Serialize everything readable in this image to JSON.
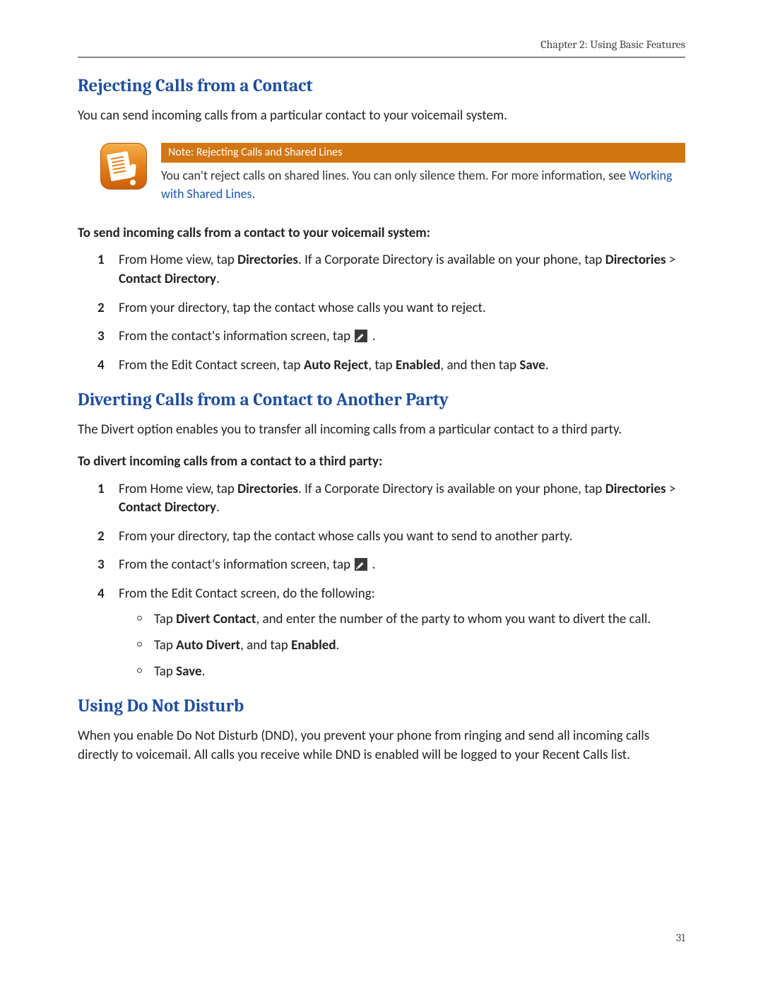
{
  "header": {
    "chapter": "Chapter 2: Using Basic Features"
  },
  "page_number": "31",
  "s1": {
    "title": "Rejecting Calls from a Contact",
    "intro": "You can send incoming calls from a particular contact to your voicemail system.",
    "note": {
      "title": "Note: Rejecting Calls and Shared Lines",
      "before_link": "You can't reject calls on shared lines. You can only silence them. For more information, see ",
      "link": "Working with Shared Lines",
      "after_link": "."
    },
    "subhead": "To send incoming calls from a contact to your voicemail system:",
    "step1_a": "From Home view, tap ",
    "step1_dir": "Directories",
    "step1_b": ". If a Corporate Directory is available on your phone, tap ",
    "step1_dir2": "Directories",
    "step1_gt": " > ",
    "step1_cd": "Contact Directory",
    "step1_end": ".",
    "step2": "From your directory, tap the contact whose calls you want to reject.",
    "step3_a": "From the contact's information screen, tap ",
    "step3_b": " .",
    "step4_a": "From the Edit Contact screen, tap ",
    "step4_ar": "Auto Reject",
    "step4_b": ", tap ",
    "step4_en": "Enabled",
    "step4_c": ", and then tap ",
    "step4_sv": "Save",
    "step4_end": "."
  },
  "s2": {
    "title": "Diverting Calls from a Contact to Another Party",
    "intro": "The Divert option enables you to transfer all incoming calls from a particular contact to a third party.",
    "subhead": "To divert incoming calls from a contact to a third party:",
    "step1_a": "From Home view, tap ",
    "step1_dir": "Directories",
    "step1_b": ". If a Corporate Directory is available on your phone, tap ",
    "step1_dir2": "Directories",
    "step1_gt": " > ",
    "step1_cd": "Contact Directory",
    "step1_end": ".",
    "step2": "From your directory, tap the contact whose calls you want to send to another party.",
    "step3_a": "From the contact's information screen, tap ",
    "step3_b": " .",
    "step4": "From the Edit Contact screen, do the following:",
    "sub1_a": "Tap ",
    "sub1_dc": "Divert Contact",
    "sub1_b": ", and enter the number of the party to whom you want to divert the call.",
    "sub2_a": "Tap ",
    "sub2_ad": "Auto Divert",
    "sub2_b": ", and tap ",
    "sub2_en": "Enabled",
    "sub2_end": ".",
    "sub3_a": "Tap ",
    "sub3_sv": "Save",
    "sub3_end": "."
  },
  "s3": {
    "title": "Using Do Not Disturb",
    "intro": "When you enable Do Not Disturb (DND), you prevent your phone from ringing and send all incoming calls directly to voicemail. All calls you receive while DND is enabled will be logged to your Recent Calls list."
  }
}
